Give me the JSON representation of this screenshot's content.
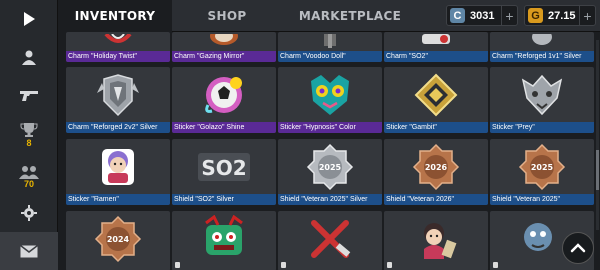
{
  "tabs": [
    {
      "label": "INVENTORY",
      "active": true
    },
    {
      "label": "SHOP",
      "active": false
    },
    {
      "label": "MARKETPLACE",
      "active": false
    }
  ],
  "currency": {
    "silver": {
      "icon": "C",
      "value": "3031",
      "plus": "+"
    },
    "gold": {
      "icon": "G",
      "value": "27.15",
      "plus": "+"
    }
  },
  "sidebar": {
    "items": [
      {
        "name": "play-icon"
      },
      {
        "name": "profile-icon"
      },
      {
        "name": "weapon-icon"
      },
      {
        "name": "trophy-icon",
        "count": "8"
      },
      {
        "name": "clan-icon",
        "count": "70"
      },
      {
        "name": "settings-icon"
      },
      {
        "name": "mail-icon"
      }
    ]
  },
  "rows": [
    [
      {
        "label": "Charm \"Holiday Twist\"",
        "color": "purple"
      },
      {
        "label": "Charm \"Gazing Mirror\"",
        "color": "purple"
      },
      {
        "label": "Charm \"Voodoo Doll\"",
        "color": "blue"
      },
      {
        "label": "Charm \"SO2\"",
        "color": "blue"
      },
      {
        "label": "Charm \"Reforged 1v1\" Silver",
        "color": "blue"
      }
    ],
    [
      {
        "label": "Charm \"Reforged 2v2\" Silver",
        "color": "blue"
      },
      {
        "label": "Sticker \"Golazo\" Shine",
        "color": "purple"
      },
      {
        "label": "Sticker \"Hypnosis\" Color",
        "color": "purple"
      },
      {
        "label": "Sticker \"Gambit\"",
        "color": "blue"
      },
      {
        "label": "Sticker \"Prey\"",
        "color": "blue"
      }
    ],
    [
      {
        "label": "Sticker \"Ramen\"",
        "color": "blue"
      },
      {
        "label": "Shield \"SO2\" Silver",
        "color": "blue"
      },
      {
        "label": "Shield \"Veteran 2025\" Silver",
        "color": "blue"
      },
      {
        "label": "Shield \"Veteran 2026\"",
        "color": "blue"
      },
      {
        "label": "Shield \"Veteran 2025\"",
        "color": "blue"
      }
    ]
  ],
  "art_text": {
    "so2": "SO2",
    "y2025": "2025",
    "y2026": "2026",
    "y2024": "2024"
  },
  "colors": {
    "bar_blue": "#1d4f8a",
    "bar_purple": "#5a2a96",
    "gold": "#e8b400",
    "silver_icon": "#5f86a6",
    "gold_icon": "#d99a1e"
  }
}
